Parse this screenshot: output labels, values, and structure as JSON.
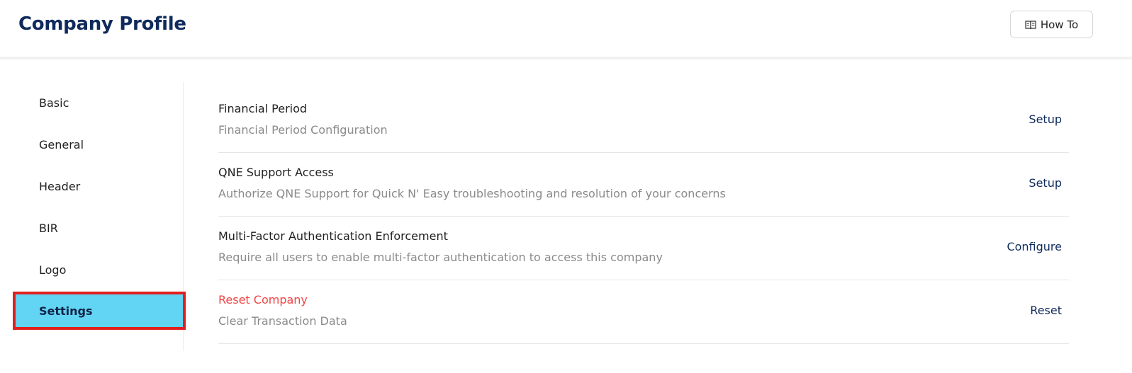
{
  "header": {
    "title": "Company Profile",
    "howto_label": "How To",
    "howto_icon": "book-icon"
  },
  "sidebar": {
    "items": [
      {
        "label": "Basic",
        "active": false
      },
      {
        "label": "General",
        "active": false
      },
      {
        "label": "Header",
        "active": false
      },
      {
        "label": "BIR",
        "active": false
      },
      {
        "label": "Logo",
        "active": false
      },
      {
        "label": "Settings",
        "active": true
      }
    ]
  },
  "settings": {
    "rows": [
      {
        "title": "Financial Period",
        "description": "Financial Period Configuration",
        "action": "Setup"
      },
      {
        "title": "QNE Support Access",
        "description": "Authorize QNE Support for Quick N' Easy troubleshooting and resolution of your concerns",
        "action": "Setup"
      },
      {
        "title": "Multi-Factor Authentication Enforcement",
        "description": "Require all users to enable multi-factor authentication to access this company",
        "action": "Configure"
      },
      {
        "title": "Reset Company",
        "description": "Clear Transaction Data",
        "action": "Reset"
      }
    ]
  },
  "colors": {
    "brand_navy": "#0f2a5c",
    "active_bg": "#62d4f4",
    "highlight_border": "#e02020",
    "danger": "#ef4444"
  }
}
